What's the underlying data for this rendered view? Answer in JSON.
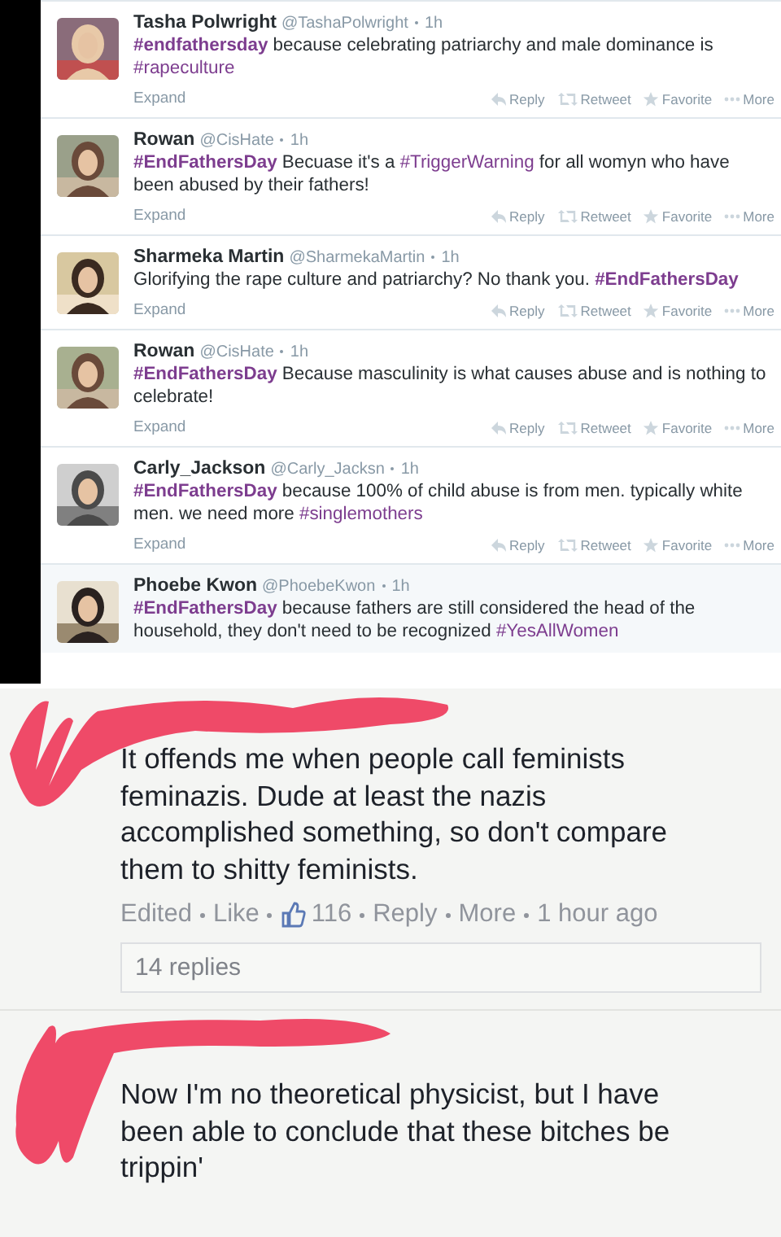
{
  "tweets": [
    {
      "name": "Tasha Polwright",
      "handle": "@TashaPolwright",
      "time": "1h",
      "body": [
        {
          "text": "#endfathersday",
          "kind": "hashtag",
          "bold": true
        },
        {
          "text": " because celebrating patriarchy and male dominance is ",
          "kind": "plain"
        },
        {
          "text": "#rapeculture",
          "kind": "hashtag",
          "bold": false
        }
      ],
      "expand": "Expand",
      "actions": [
        "Reply",
        "Retweet",
        "Favorite",
        "More"
      ]
    },
    {
      "name": "Rowan",
      "handle": "@CisHate",
      "time": "1h",
      "body": [
        {
          "text": "#EndFathersDay",
          "kind": "hashtag",
          "bold": true
        },
        {
          "text": " Becuase it's a ",
          "kind": "plain"
        },
        {
          "text": "#TriggerWarning",
          "kind": "hashtag",
          "bold": false
        },
        {
          "text": " for all womyn who have been abused by their fathers!",
          "kind": "plain"
        }
      ],
      "expand": "Expand",
      "actions": [
        "Reply",
        "Retweet",
        "Favorite",
        "More"
      ]
    },
    {
      "name": "Sharmeka Martin",
      "handle": "@SharmekaMartin",
      "time": "1h",
      "body": [
        {
          "text": "Glorifying the rape culture and patriarchy? No thank you. ",
          "kind": "plain"
        },
        {
          "text": "#EndFathersDay",
          "kind": "hashtag",
          "bold": true
        }
      ],
      "expand": "Expand",
      "actions": [
        "Reply",
        "Retweet",
        "Favorite",
        "More"
      ]
    },
    {
      "name": "Rowan",
      "handle": "@CisHate",
      "time": "1h",
      "body": [
        {
          "text": "#EndFathersDay",
          "kind": "hashtag",
          "bold": true
        },
        {
          "text": " Because masculinity is what causes abuse and is nothing to celebrate!",
          "kind": "plain"
        }
      ],
      "expand": "Expand",
      "actions": [
        "Reply",
        "Retweet",
        "Favorite",
        "More"
      ]
    },
    {
      "name": "Carly_Jackson",
      "handle": "@Carly_Jacksn",
      "time": "1h",
      "body": [
        {
          "text": "#EndFathersDay",
          "kind": "hashtag",
          "bold": true
        },
        {
          "text": " because 100% of child abuse is from men. typically white men. we need more ",
          "kind": "plain"
        },
        {
          "text": "#singlemothers",
          "kind": "hashtag",
          "bold": false
        }
      ],
      "expand": "Expand",
      "actions": [
        "Reply",
        "Retweet",
        "Favorite",
        "More"
      ]
    },
    {
      "name": "Phoebe Kwon",
      "handle": "@PhoebeKwon",
      "time": "1h",
      "body": [
        {
          "text": "#EndFathersDay",
          "kind": "hashtag",
          "bold": true
        },
        {
          "text": " because fathers are still considered the head of the household, they don't need to be recognized ",
          "kind": "plain"
        },
        {
          "text": "#YesAllWomen",
          "kind": "hashtag",
          "bold": false
        }
      ]
    }
  ],
  "comments": [
    {
      "text": "It offends me when people call feminists feminazis. Dude at least the nazis accomplished something, so don't compare them to shitty feminists.",
      "meta": {
        "edited": "Edited",
        "like": "Like",
        "likes": "116",
        "reply": "Reply",
        "more": "More",
        "time": "1 hour ago"
      },
      "replies": "14 replies"
    },
    {
      "text": "Now I'm no theoretical physicist, but I have been able to conclude that these bitches be trippin'"
    }
  ]
}
